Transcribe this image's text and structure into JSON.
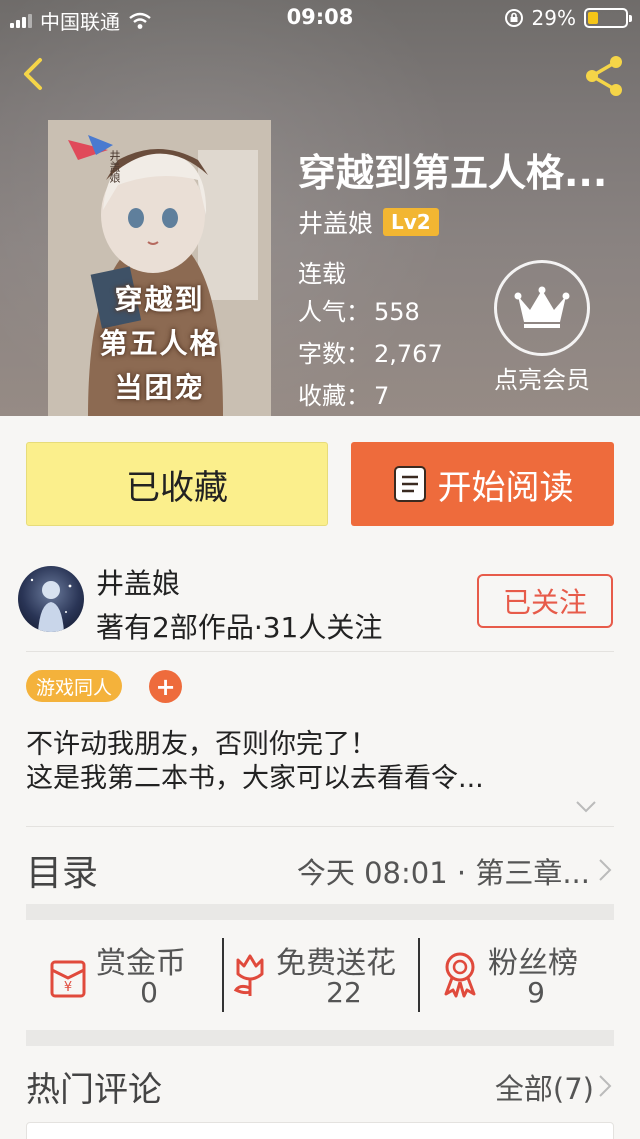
{
  "status_bar": {
    "carrier": "中国联通",
    "time": "09:08",
    "battery": "29%",
    "battery_level": 0.29
  },
  "book": {
    "title": "穿越到第五人格...",
    "cover_text": [
      "穿越到",
      "第五人格",
      "当团宠"
    ],
    "cover_tag": "井盖娘",
    "author": "井盖娘",
    "level": "Lv2",
    "status": "连载",
    "popularity_label": "人气：",
    "popularity": "558",
    "words_label": "字数：",
    "words": "2,767",
    "favorites_label": "收藏：",
    "favorites": "7"
  },
  "vip": {
    "label": "点亮会员"
  },
  "actions": {
    "favorited_label": "已收藏",
    "read_label": "开始阅读"
  },
  "author_card": {
    "name": "井盖娘",
    "meta": "著有2部作品·31人关注",
    "follow_label": "已关注"
  },
  "tags": {
    "items": [
      "游戏同人"
    ],
    "add": "+"
  },
  "description": {
    "line1": "不许动我朋友，否则你完了！",
    "line2": "这是我第二本书，大家可以去看看令..."
  },
  "toc": {
    "title": "目录",
    "latest": "今天 08:01 · 第三章..."
  },
  "interactions": {
    "reward_label": "赏金币",
    "reward_value": "0",
    "flower_label": "免费送花",
    "flower_value": "22",
    "fans_label": "粉丝榜",
    "fans_value": "9"
  },
  "comments": {
    "title": "热门评论",
    "all_label": "全部(7)"
  },
  "colors": {
    "accent_orange": "#ee6b3c",
    "favorite_yellow": "#fbef8c",
    "follow_red": "#e75b4a",
    "tag_orange": "#f4b23b",
    "level_gold": "#f2b632"
  },
  "icons": {
    "back": "chevron-left-icon",
    "share": "share-icon",
    "vip": "crown-icon",
    "read": "book-icon",
    "reward": "red-envelope-icon",
    "flower": "flower-icon",
    "fans": "medal-icon",
    "expand": "chevron-down-icon"
  }
}
